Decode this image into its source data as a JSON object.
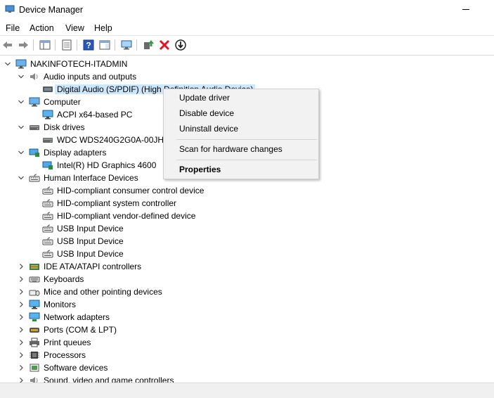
{
  "window": {
    "title": "Device Manager"
  },
  "menu": [
    "File",
    "Action",
    "View",
    "Help"
  ],
  "toolbar": [
    "back-icon",
    "forward-icon",
    "show-hide-console-tree-icon",
    "properties-icon",
    "help-icon",
    "action-pane-icon",
    "scan-hardware-icon",
    "update-driver-icon",
    "uninstall-icon",
    "disable-device-icon"
  ],
  "tree": {
    "root": "NAKINFOTECH-ITADMIN",
    "rows": [
      {
        "label": "Audio inputs and outputs",
        "level": 1,
        "exp": "open",
        "icon": "speaker-icon"
      },
      {
        "label": "Digital Audio (S/PDIF) (High Definition Audio Device)",
        "level": 2,
        "exp": "none",
        "icon": "audio-device-icon",
        "selected": true
      },
      {
        "label": "Computer",
        "level": 1,
        "exp": "open",
        "icon": "computer-icon"
      },
      {
        "label": "ACPI x64-based PC",
        "level": 2,
        "exp": "none",
        "icon": "monitor-icon"
      },
      {
        "label": "Disk drives",
        "level": 1,
        "exp": "open",
        "icon": "disk-drive-icon"
      },
      {
        "label": "WDC WDS240G2G0A-00JH30",
        "level": 2,
        "exp": "none",
        "icon": "disk-drive-icon"
      },
      {
        "label": "Display adapters",
        "level": 1,
        "exp": "open",
        "icon": "display-adapter-icon"
      },
      {
        "label": "Intel(R) HD Graphics 4600",
        "level": 2,
        "exp": "none",
        "icon": "display-adapter-icon"
      },
      {
        "label": "Human Interface Devices",
        "level": 1,
        "exp": "open",
        "icon": "hid-icon"
      },
      {
        "label": "HID-compliant consumer control device",
        "level": 2,
        "exp": "none",
        "icon": "hid-icon"
      },
      {
        "label": "HID-compliant system controller",
        "level": 2,
        "exp": "none",
        "icon": "hid-icon"
      },
      {
        "label": "HID-compliant vendor-defined device",
        "level": 2,
        "exp": "none",
        "icon": "hid-icon"
      },
      {
        "label": "USB Input Device",
        "level": 2,
        "exp": "none",
        "icon": "hid-icon"
      },
      {
        "label": "USB Input Device",
        "level": 2,
        "exp": "none",
        "icon": "hid-icon"
      },
      {
        "label": "USB Input Device",
        "level": 2,
        "exp": "none",
        "icon": "hid-icon"
      },
      {
        "label": "IDE ATA/ATAPI controllers",
        "level": 1,
        "exp": "closed",
        "icon": "ide-icon"
      },
      {
        "label": "Keyboards",
        "level": 1,
        "exp": "closed",
        "icon": "keyboard-icon"
      },
      {
        "label": "Mice and other pointing devices",
        "level": 1,
        "exp": "closed",
        "icon": "mouse-icon"
      },
      {
        "label": "Monitors",
        "level": 1,
        "exp": "closed",
        "icon": "monitor-icon"
      },
      {
        "label": "Network adapters",
        "level": 1,
        "exp": "closed",
        "icon": "network-icon"
      },
      {
        "label": "Ports (COM & LPT)",
        "level": 1,
        "exp": "closed",
        "icon": "port-icon"
      },
      {
        "label": "Print queues",
        "level": 1,
        "exp": "closed",
        "icon": "printer-icon"
      },
      {
        "label": "Processors",
        "level": 1,
        "exp": "closed",
        "icon": "processor-icon"
      },
      {
        "label": "Software devices",
        "level": 1,
        "exp": "closed",
        "icon": "software-icon"
      },
      {
        "label": "Sound, video and game controllers",
        "level": 1,
        "exp": "closed",
        "icon": "speaker-icon"
      }
    ]
  },
  "context_menu": {
    "items": [
      "Update driver",
      "Disable device",
      "Uninstall device",
      "Scan for hardware changes",
      "Properties"
    ]
  },
  "colors": {
    "selection": "#cce8ff",
    "accent": "#0078d7",
    "error_red": "#e81123"
  }
}
